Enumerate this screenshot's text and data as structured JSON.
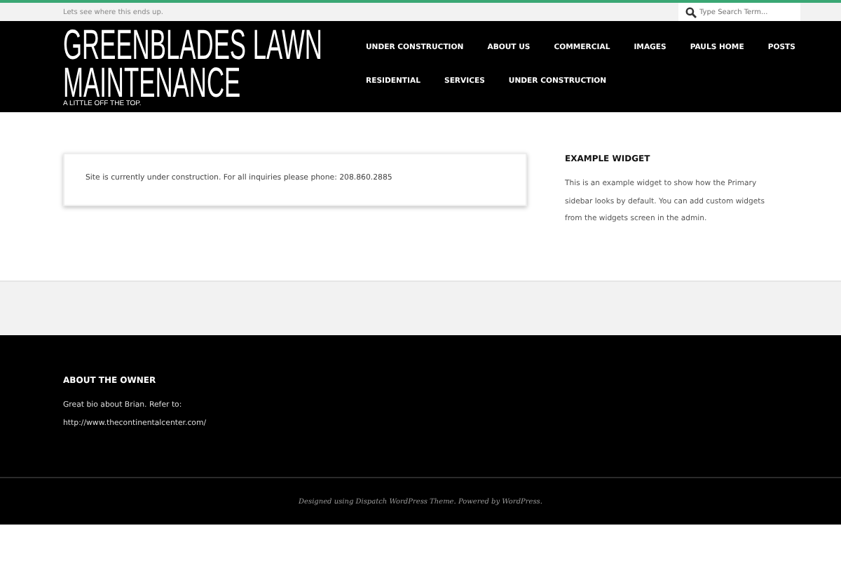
{
  "topbar": {
    "tagline": "Lets see where this ends up.",
    "search": {
      "placeholder": "Type Search Term..."
    }
  },
  "header": {
    "title_lines": [
      "GREENBLADES LAWN",
      "MAINTENANCE"
    ],
    "subtitle": "A LITTLE OFF THE TOP.",
    "nav_rows": [
      [
        "UNDER CONSTRUCTION",
        "ABOUT US",
        "COMMERCIAL",
        "IMAGES",
        "PAULS HOME",
        "POSTS"
      ],
      [
        "RESIDENTIAL",
        "SERVICES",
        "UNDER CONSTRUCTION"
      ]
    ]
  },
  "content": {
    "notice": "Site is currently under construction. For all inquiries please phone: 208.860.2885"
  },
  "sidebar": {
    "title": "EXAMPLE WIDGET",
    "text": "This is an example widget to show how the Primary sidebar looks by default. You can add custom widgets from the widgets screen in the admin."
  },
  "footer": {
    "title": "ABOUT THE OWNER",
    "lines": [
      "Great bio about Brian. Refer to:",
      "http://www.thecontinentalcenter.com/"
    ]
  },
  "credits": "Designed using Dispatch WordPress Theme. Powered by WordPress."
}
